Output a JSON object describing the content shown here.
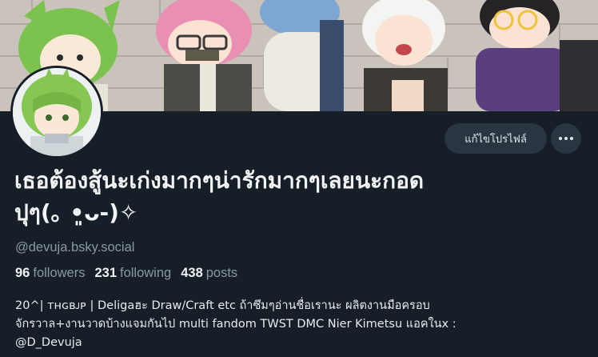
{
  "profile": {
    "display_name": "เธอต้องสู้นะเก่งมากๆน่ารักมากๆเลยนะกอด\nปุๆ(｡ •͈ᴗ-)✧",
    "handle": "@devuja.bsky.social",
    "bio": "20^| ᴛʜɢʙᴊᴘ | Deligaฮะ Draw/Craft etc ถ้าซึมๆอ่านชื่อเรานะ ผลิตงานมือครอบ\nจักรวาล+งานวาดบ้างแจมกันไป multi fandom TWST DMC Nier Kimetsu แอคในx :\n@D_Devuja"
  },
  "stats": {
    "followers_count": "96",
    "followers_label": "followers",
    "following_count": "231",
    "following_label": "following",
    "posts_count": "438",
    "posts_label": "posts"
  },
  "actions": {
    "edit_profile_label": "แก้ไขโปรไฟล์",
    "more_icon": "ellipsis-icon"
  },
  "colors": {
    "background": "#161e27",
    "button_bg": "#2a3542",
    "muted_text": "#8a97a6",
    "primary_text": "#f1f3f5"
  }
}
